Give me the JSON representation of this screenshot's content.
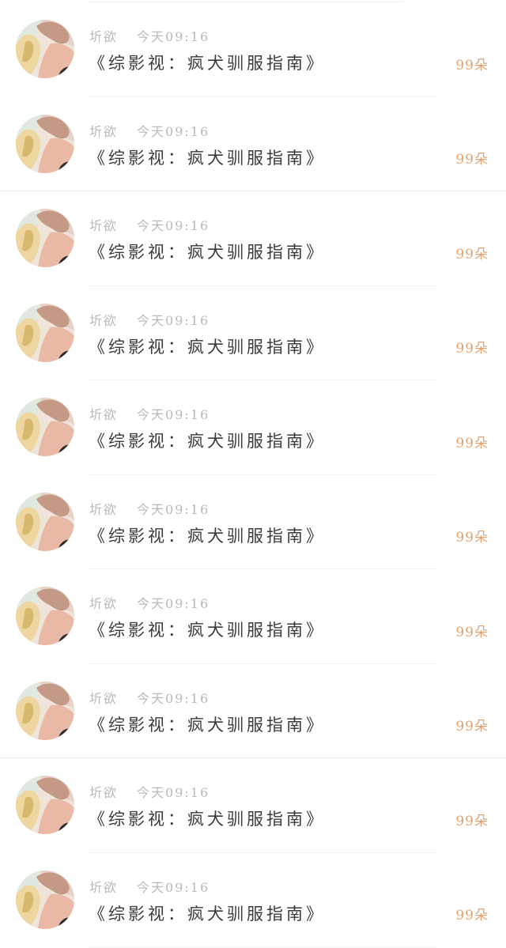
{
  "list": {
    "items": [
      {
        "author": "圻欲",
        "time": "今天09:16",
        "title": "《综影视：疯犬驯服指南》",
        "count": "99朵"
      },
      {
        "author": "圻欲",
        "time": "今天09:16",
        "title": "《综影视：疯犬驯服指南》",
        "count": "99朵"
      },
      {
        "author": "圻欲",
        "time": "今天09:16",
        "title": "《综影视：疯犬驯服指南》",
        "count": "99朵"
      },
      {
        "author": "圻欲",
        "time": "今天09:16",
        "title": "《综影视：疯犬驯服指南》",
        "count": "99朵"
      },
      {
        "author": "圻欲",
        "time": "今天09:16",
        "title": "《综影视：疯犬驯服指南》",
        "count": "99朵"
      },
      {
        "author": "圻欲",
        "time": "今天09:16",
        "title": "《综影视：疯犬驯服指南》",
        "count": "99朵"
      },
      {
        "author": "圻欲",
        "time": "今天09:16",
        "title": "《综影视：疯犬驯服指南》",
        "count": "99朵"
      },
      {
        "author": "圻欲",
        "time": "今天09:16",
        "title": "《综影视：疯犬驯服指南》",
        "count": "99朵"
      },
      {
        "author": "圻欲",
        "time": "今天09:16",
        "title": "《综影视：疯犬驯服指南》",
        "count": "99朵"
      },
      {
        "author": "圻欲",
        "time": "今天09:16",
        "title": "《综影视：疯犬驯服指南》",
        "count": "99朵"
      }
    ]
  },
  "colors": {
    "meta_text": "#b9b9b9",
    "title_text": "#3a3a3a",
    "count_accent": "#e3a370"
  }
}
